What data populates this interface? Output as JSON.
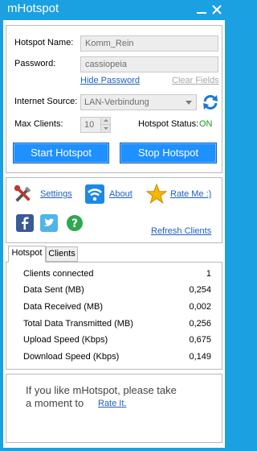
{
  "window": {
    "title": "mHotspot"
  },
  "hotspot": {
    "name_label": "Hotspot Name:",
    "name_value": "Komm_Rein",
    "password_label": "Password:",
    "password_value": "cassiopeia",
    "hide_password": "Hide Password",
    "clear_fields": "Clear Fields",
    "internet_source_label": "Internet Source:",
    "internet_source_value": "LAN-Verbindung",
    "max_clients_label": "Max Clients:",
    "max_clients_value": "10",
    "status_label": "Hotspot Status:",
    "status_value": "ON",
    "start_button": "Start Hotspot",
    "stop_button": "Stop Hotspot"
  },
  "links": {
    "settings": "Settings",
    "about": "About",
    "rate_me": "Rate Me :)",
    "refresh_clients": "Refresh Clients"
  },
  "tabs": [
    {
      "label": "Hotspot",
      "active": true
    },
    {
      "label": "Clients",
      "active": false
    }
  ],
  "stats": [
    {
      "label": "Clients connected",
      "value": "1"
    },
    {
      "label": "Data Sent (MB)",
      "value": "0,254"
    },
    {
      "label": "Data Received (MB)",
      "value": "0,002"
    },
    {
      "label": "Total Data Transmitted (MB)",
      "value": "0,256"
    },
    {
      "label": "Upload Speed (Kbps)",
      "value": "0,675"
    },
    {
      "label": "Download Speed (Kbps)",
      "value": "0,149"
    }
  ],
  "footer": {
    "line1": "If you like mHotspot, please take",
    "line2": "a moment to",
    "rate_link": "Rate It."
  },
  "icons": {
    "settings": "tools-icon",
    "about": "wifi-icon",
    "rate": "star-icon",
    "refresh": "refresh-icon",
    "facebook": "facebook-icon",
    "twitter": "twitter-icon",
    "help": "help-icon"
  },
  "colors": {
    "titlebar": "#1ba1e2",
    "button": "#1e90ff",
    "link": "#1f5fbf",
    "status_on": "#1a9a1a"
  }
}
